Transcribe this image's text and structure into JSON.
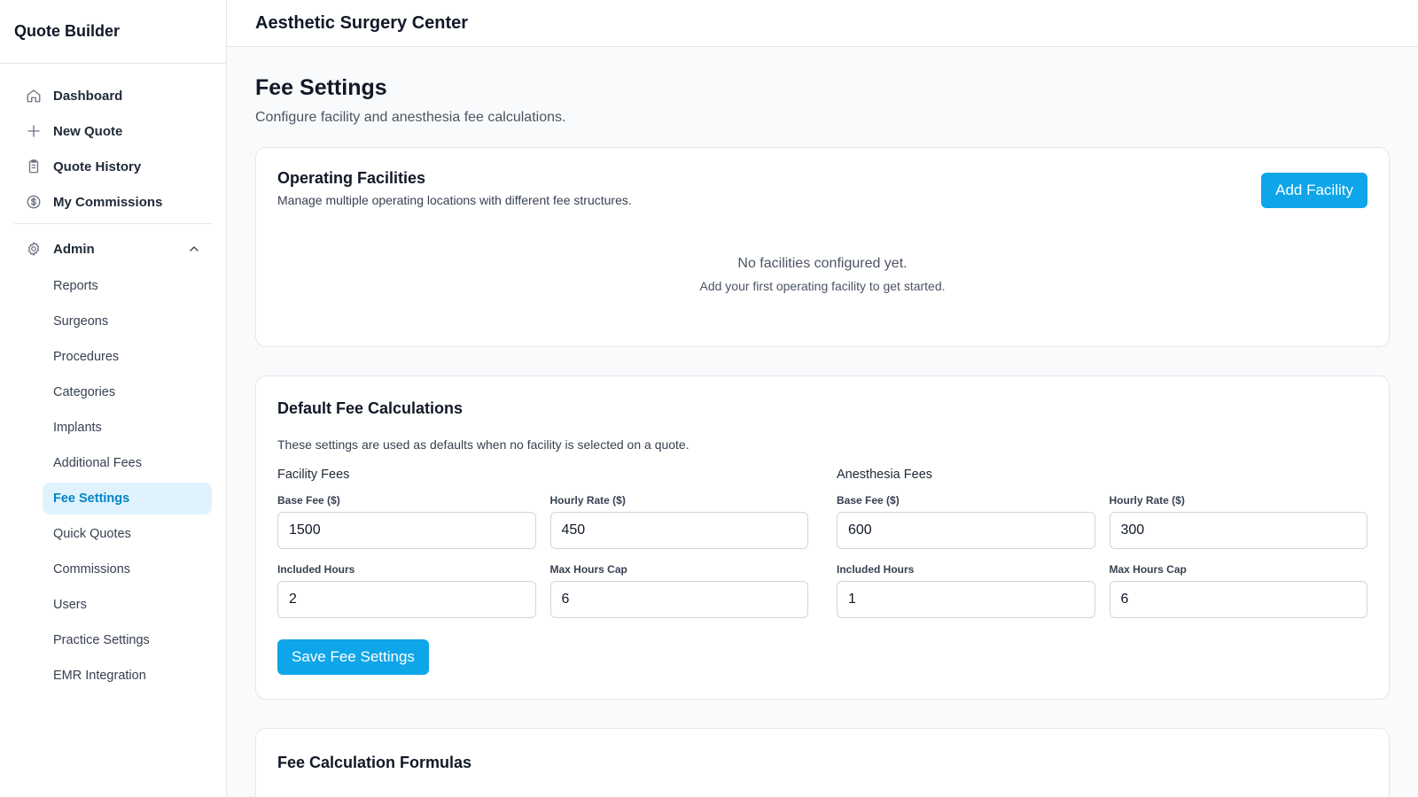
{
  "sidebar": {
    "brand": "Quote Builder",
    "items": [
      {
        "label": "Dashboard",
        "icon": "home-icon"
      },
      {
        "label": "New Quote",
        "icon": "plus-icon"
      },
      {
        "label": "Quote History",
        "icon": "clipboard-icon"
      },
      {
        "label": "My Commissions",
        "icon": "dollar-circle-icon"
      }
    ],
    "admin": {
      "label": "Admin",
      "icon": "gear-icon",
      "expanded": true,
      "items": [
        {
          "label": "Reports"
        },
        {
          "label": "Surgeons"
        },
        {
          "label": "Procedures"
        },
        {
          "label": "Categories"
        },
        {
          "label": "Implants"
        },
        {
          "label": "Additional Fees"
        },
        {
          "label": "Fee Settings",
          "active": true
        },
        {
          "label": "Quick Quotes"
        },
        {
          "label": "Commissions"
        },
        {
          "label": "Users"
        },
        {
          "label": "Practice Settings"
        },
        {
          "label": "EMR Integration"
        }
      ]
    }
  },
  "header": {
    "title": "Aesthetic Surgery Center"
  },
  "page": {
    "title": "Fee Settings",
    "subtitle": "Configure facility and anesthesia fee calculations."
  },
  "facilities": {
    "title": "Operating Facilities",
    "description": "Manage multiple operating locations with different fee structures.",
    "add_label": "Add Facility",
    "empty_title": "No facilities configured yet.",
    "empty_sub": "Add your first operating facility to get started."
  },
  "defaults": {
    "title": "Default Fee Calculations",
    "note": "These settings are used as defaults when no facility is selected on a quote.",
    "facility": {
      "title": "Facility Fees",
      "base_fee_label": "Base Fee ($)",
      "base_fee": "1500",
      "hourly_rate_label": "Hourly Rate ($)",
      "hourly_rate": "450",
      "included_hours_label": "Included Hours",
      "included_hours": "2",
      "max_hours_label": "Max Hours Cap",
      "max_hours": "6"
    },
    "anesthesia": {
      "title": "Anesthesia Fees",
      "base_fee_label": "Base Fee ($)",
      "base_fee": "600",
      "hourly_rate_label": "Hourly Rate ($)",
      "hourly_rate": "300",
      "included_hours_label": "Included Hours",
      "included_hours": "1",
      "max_hours_label": "Max Hours Cap",
      "max_hours": "6"
    },
    "save_label": "Save Fee Settings"
  },
  "formulas": {
    "title": "Fee Calculation Formulas"
  },
  "colors": {
    "accent": "#0ea5e9",
    "active_bg": "#e0f2fe",
    "active_text": "#0284c7",
    "border": "#e5e7eb",
    "page_bg": "#f9fafb"
  }
}
